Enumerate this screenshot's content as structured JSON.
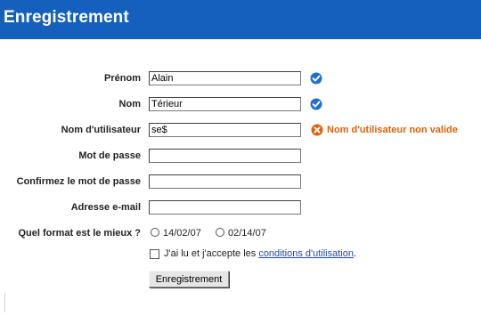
{
  "header": {
    "title": "Enregistrement"
  },
  "form": {
    "first_name": {
      "label": "Prénom",
      "value": "Alain",
      "status": "valid"
    },
    "last_name": {
      "label": "Nom",
      "value": "Térieur",
      "status": "valid"
    },
    "username": {
      "label": "Nom d'utilisateur",
      "value": "se$",
      "status": "invalid",
      "error": "Nom d'utilisateur non valide"
    },
    "password": {
      "label": "Mot de passe",
      "value": ""
    },
    "confirm_password": {
      "label": "Confirmez le mot de passe",
      "value": ""
    },
    "email": {
      "label": "Adresse e-mail",
      "value": ""
    },
    "format": {
      "label": "Quel format est le mieux ?",
      "options": [
        "14/02/07",
        "02/14/07"
      ],
      "selected": null
    },
    "terms": {
      "prefix": "J'ai lu et j'accepte les ",
      "link": "conditions d'utilisation",
      "suffix": ".",
      "checked": false
    },
    "submit_label": "Enregistrement"
  },
  "colors": {
    "header_bg": "#1560bd",
    "valid_icon": "#1d6fd1",
    "error": "#e0600a",
    "link": "#1f4aa8"
  },
  "icons": {
    "valid": "checkmark-circle-icon",
    "error": "error-x-circle-icon"
  }
}
